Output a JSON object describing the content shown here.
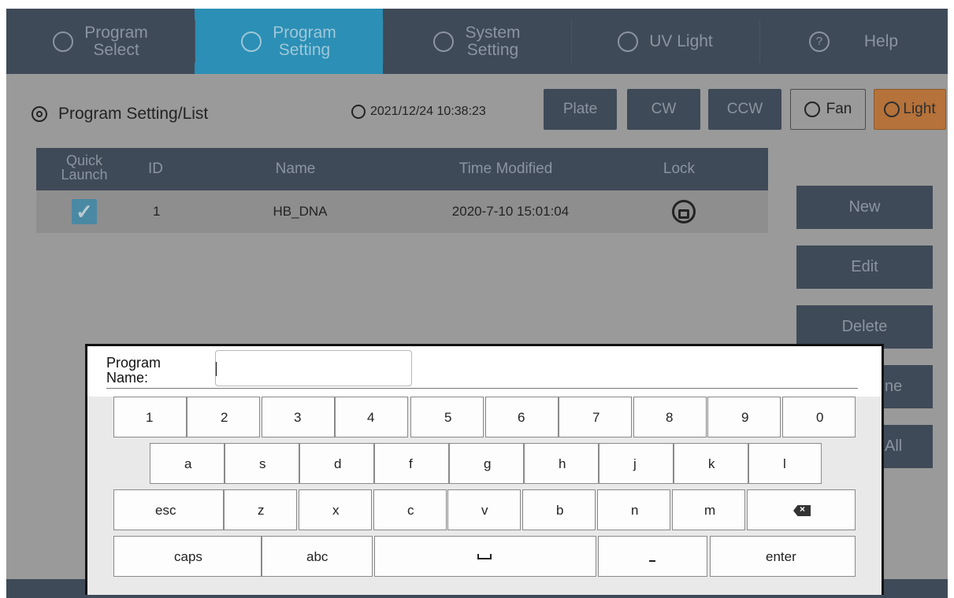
{
  "nav": {
    "tabs": [
      {
        "line1": "Program",
        "line2": "Select",
        "icon": "gear-icon",
        "active": false
      },
      {
        "line1": "Program",
        "line2": "Setting",
        "icon": "list-icon",
        "active": true
      },
      {
        "line1": "System",
        "line2": "Setting",
        "icon": "settings-icon",
        "active": false
      },
      {
        "line1": "UV Light",
        "line2": "",
        "icon": "uv-light-icon",
        "active": false
      },
      {
        "line1": "Help",
        "line2": "",
        "icon": "help-icon",
        "active": false
      }
    ],
    "help_glyph": "?"
  },
  "toolbar": {
    "breadcrumb": "Program Setting/List",
    "datetime": "2021/12/24 10:38:23",
    "plate": "Plate",
    "cw": "CW",
    "ccw": "CCW",
    "fan": "Fan",
    "light": "Light"
  },
  "table": {
    "headers": {
      "quick_launch_1": "Quick",
      "quick_launch_2": "Launch",
      "id": "ID",
      "name": "Name",
      "time_modified": "Time Modified",
      "lock": "Lock"
    },
    "rows": [
      {
        "checked": true,
        "id": "1",
        "name": "HB_DNA",
        "time_modified": "2020-7-10 15:01:04",
        "locked": false
      }
    ]
  },
  "side_buttons": {
    "new": "New",
    "edit": "Edit",
    "delete": "Delete",
    "partial_4": "ne",
    "partial_5": "All"
  },
  "keyboard": {
    "label_line1": "Program",
    "label_line2": "Name:",
    "input_value": "",
    "row1": [
      "1",
      "2",
      "3",
      "4",
      "5",
      "6",
      "7",
      "8",
      "9",
      "0"
    ],
    "row2": [
      "a",
      "s",
      "d",
      "f",
      "g",
      "h",
      "j",
      "k",
      "l"
    ],
    "row3": [
      "esc",
      "z",
      "x",
      "c",
      "v",
      "b",
      "n",
      "m"
    ],
    "row4": [
      "caps",
      "abc",
      "",
      "",
      "enter"
    ]
  },
  "colors": {
    "nav_bg": "#3f4a58",
    "nav_active": "#2c8fb5",
    "light_button": "#b5723a",
    "checkbox": "#4a89a3"
  }
}
